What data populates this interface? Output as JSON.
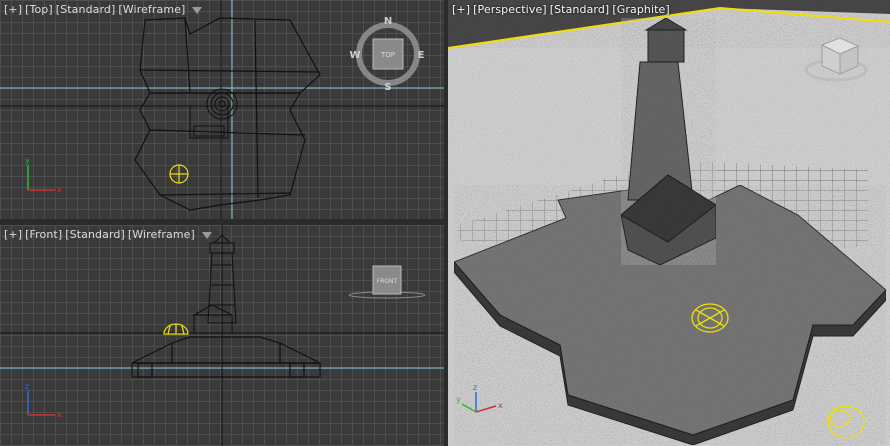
{
  "viewports": {
    "top": {
      "labels": [
        "[+]",
        "[Top]",
        "[Standard]",
        "[Wireframe]"
      ]
    },
    "front": {
      "labels": [
        "[+]",
        "[Front]",
        "[Standard]",
        "[Wireframe]"
      ]
    },
    "perspective": {
      "labels": [
        "[+]",
        "[Perspective]",
        "[Standard]",
        "[Graphite]"
      ]
    }
  },
  "view_compass": {
    "north": "N",
    "south": "S",
    "east": "E",
    "west": "W",
    "cube_face": "TOP"
  },
  "front_viewcube": {
    "cube_face": "FRONT"
  },
  "colors": {
    "grid_bg": "#3a3a3a",
    "grid_line": "#4e4e4e",
    "home_grid_axis": "#7ecbd6",
    "selection": "#f0e000",
    "active_border": "#d4b13a"
  },
  "icons": [
    "filter-icon",
    "view-compass-icon",
    "viewcube-icon",
    "axis-tripod-icon",
    "light-gizmo-icon"
  ]
}
